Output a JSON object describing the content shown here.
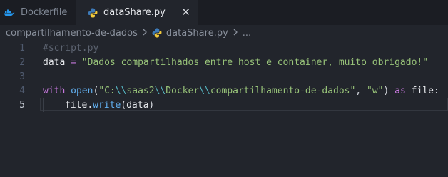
{
  "tabs": [
    {
      "label": "Dockerfile",
      "icon": "docker-icon",
      "active": false
    },
    {
      "label": "dataShare.py",
      "icon": "python-icon",
      "active": true,
      "close": "✕"
    }
  ],
  "breadcrumb": {
    "folder": "compartilhamento-de-dados",
    "file": "dataShare.py",
    "more": "..."
  },
  "editor": {
    "line_numbers": [
      "1",
      "2",
      "3",
      "4",
      "5"
    ],
    "current_line": 5,
    "lines": {
      "l1": {
        "comment": "#script.py"
      },
      "l2": {
        "var": "data",
        "op": " = ",
        "str": "\"Dados compartilhados entre host e container, muito obrigado!\""
      },
      "l4": {
        "kw_with": "with",
        "fn_open": "open",
        "paren_open": "(",
        "str_a": "\"C:",
        "esc1": "\\\\",
        "str_b": "saas2",
        "esc2": "\\\\",
        "str_c": "Docker",
        "esc3": "\\\\",
        "str_d": "compartilhamento-de-dados\"",
        "comma": ", ",
        "str_mode": "\"w\"",
        "paren_close": ")",
        "kw_as": " as ",
        "var_file": "file",
        "colon": ":"
      },
      "l5": {
        "var_file": "file",
        "dot": ".",
        "fn_write": "write",
        "paren_open": "(",
        "var_data": "data",
        "paren_close": ")"
      }
    }
  },
  "colors": {
    "editor_bg": "#22252c",
    "tabbar_bg": "#1b1d23",
    "string": "#98c379",
    "keyword": "#c678dd",
    "function": "#61afef",
    "escape": "#56b6c2",
    "comment": "#5c6370"
  }
}
